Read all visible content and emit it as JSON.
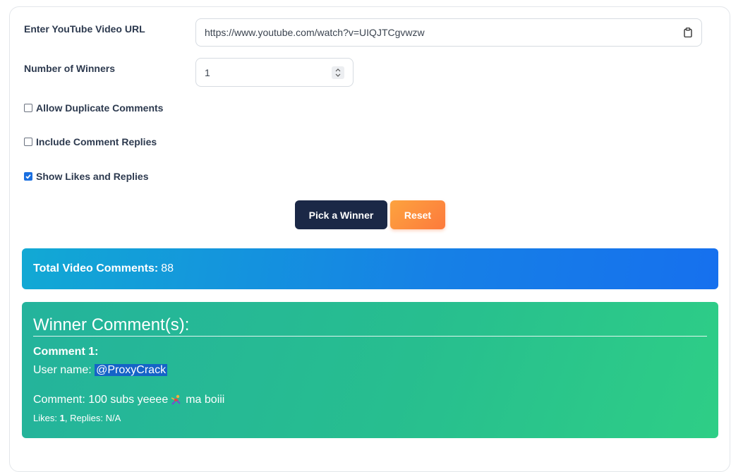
{
  "form": {
    "url_label": "Enter YouTube Video URL",
    "url_value": "https://www.youtube.com/watch?v=UIQJTCgvwzw",
    "winners_label": "Number of Winners",
    "winners_value": "1",
    "icons": {
      "clipboard": "clipboard-icon",
      "spinner": "spinner-arrows-icon"
    },
    "options": [
      {
        "label": "Allow Duplicate Comments",
        "checked": false
      },
      {
        "label": "Include Comment Replies",
        "checked": false
      },
      {
        "label": "Show Likes and Replies",
        "checked": true
      }
    ]
  },
  "buttons": {
    "pick_label": "Pick a Winner",
    "reset_label": "Reset"
  },
  "total": {
    "label": "Total Video Comments:",
    "value": "88"
  },
  "winner": {
    "title": "Winner Comment(s):",
    "comment_heading": "Comment 1:",
    "user_prefix": "User name: ",
    "username": "@ProxyCrack",
    "comment_prefix": "Comment: 100 subs yeeee",
    "comment_emoji": "climbing-person-emoji",
    "comment_suffix": "ma boiii",
    "likes_label": "Likes:",
    "likes_value": "1",
    "replies_label": "Replies:",
    "replies_value": "N/A"
  },
  "colors": {
    "primary_button": "#1b2846",
    "reset_button": "#fd8d3d",
    "total_gradient_start": "#12a9d4",
    "total_gradient_end": "#1670ee",
    "winner_gradient_start": "#24b39c",
    "winner_gradient_end": "#2ece86",
    "checkbox_checked": "#1a6fe0"
  }
}
